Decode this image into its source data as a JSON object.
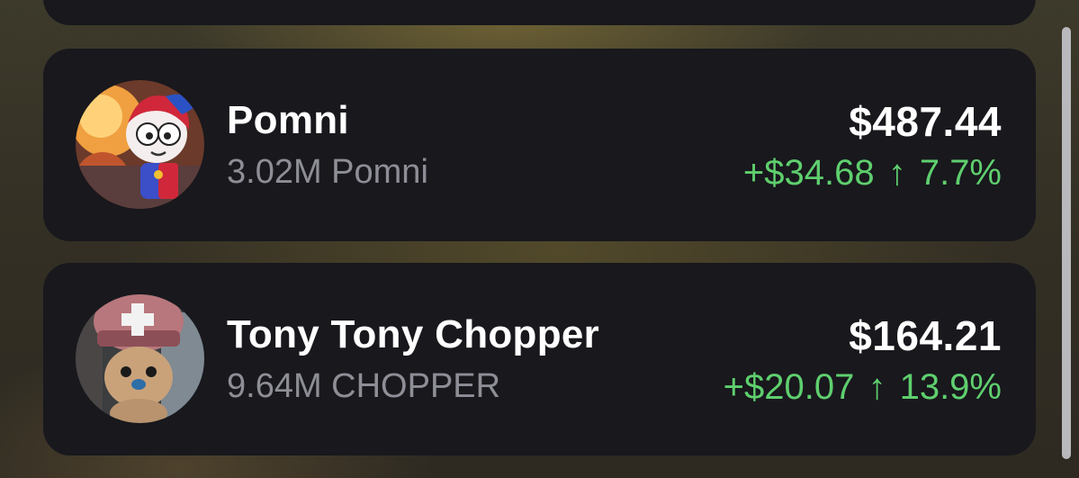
{
  "colors": {
    "card_background": "#18181d",
    "primary_text": "#ffffff",
    "secondary_text": "#8e8e96",
    "positive": "#5fcf6e"
  },
  "holdings": [
    {
      "name": "Pomni",
      "amount": "3.02M Pomni",
      "price": "$487.44",
      "change_value": "+$34.68",
      "change_icon": "arrow-up-icon",
      "change_arrow": "↑",
      "change_percent": "7.7%"
    },
    {
      "name": "Tony Tony Chopper",
      "amount": "9.64M CHOPPER",
      "price": "$164.21",
      "change_value": "+$20.07",
      "change_icon": "arrow-up-icon",
      "change_arrow": "↑",
      "change_percent": "13.9%"
    }
  ]
}
